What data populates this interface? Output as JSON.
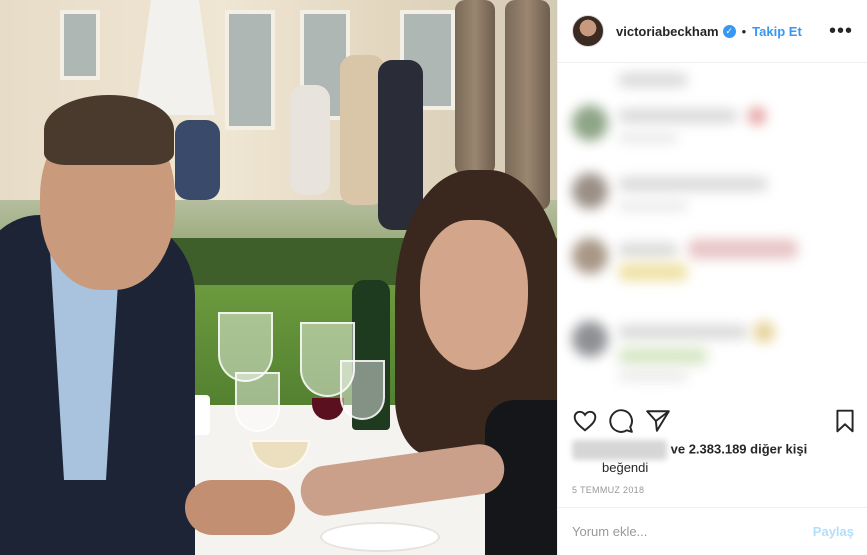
{
  "header": {
    "username": "victoriabeckham",
    "separator": "•",
    "follow_label": "Takip Et",
    "more_label": "•••",
    "verified_mark": "✓"
  },
  "icons": {
    "like": "heart-icon",
    "comment": "comment-icon",
    "share": "paper-plane-icon",
    "save": "bookmark-icon",
    "more": "more-options-icon",
    "verified": "verified-badge-icon"
  },
  "likes": {
    "others_text": "ve 2.383.189 diğer kişi",
    "liked_label": "beğendi"
  },
  "date": "5 TEMMUZ 2018",
  "comment_box": {
    "placeholder": "Yorum ekle...",
    "post_label": "Paylaş"
  },
  "colors": {
    "accent": "#3897f0",
    "post_disabled": "#b2dffc",
    "muted": "#999999"
  }
}
